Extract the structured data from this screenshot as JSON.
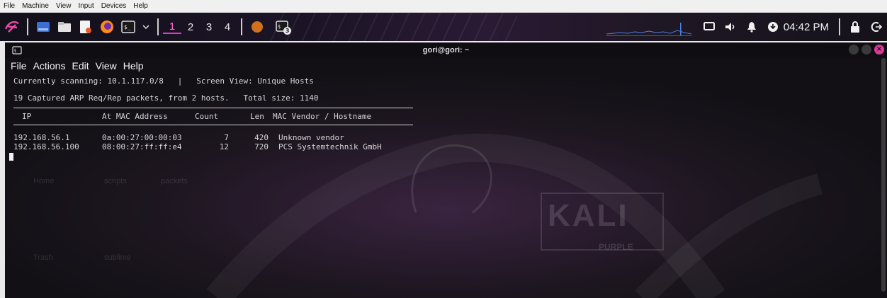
{
  "vbox_menu": [
    "File",
    "Machine",
    "View",
    "Input",
    "Devices",
    "Help"
  ],
  "panel": {
    "workspaces": [
      "1",
      "2",
      "3",
      "4"
    ],
    "active_workspace": "1",
    "terminal_badge": "3",
    "clock": "04:42 PM",
    "tray_icons": [
      "display-icon",
      "volume-icon",
      "bell-icon",
      "update-icon"
    ],
    "accent": "#d63ad0"
  },
  "terminal": {
    "title": "gori@gori: ~",
    "menu": [
      "File",
      "Actions",
      "Edit",
      "View",
      "Help"
    ],
    "scan_line": "Currently scanning: 10.1.117.0/8   |   Screen View: Unique Hosts",
    "captured_line": "19 Captured ARP Req/Rep packets, from 2 hosts.   Total size: 1140",
    "headers": [
      "IP",
      "At MAC Address",
      "Count",
      "Len",
      "MAC Vendor / Hostname"
    ],
    "rows": [
      {
        "ip": "192.168.56.1",
        "mac": "0a:00:27:00:00:03",
        "count": "7",
        "len": "420",
        "vendor": "Unknown vendor"
      },
      {
        "ip": "192.168.56.100",
        "mac": "08:00:27:ff:ff:e4",
        "count": "12",
        "len": "720",
        "vendor": "PCS Systemtechnik GmbH"
      }
    ]
  },
  "desktop": {
    "logo_text": "KALI",
    "logo_sub": "PURPLE"
  }
}
